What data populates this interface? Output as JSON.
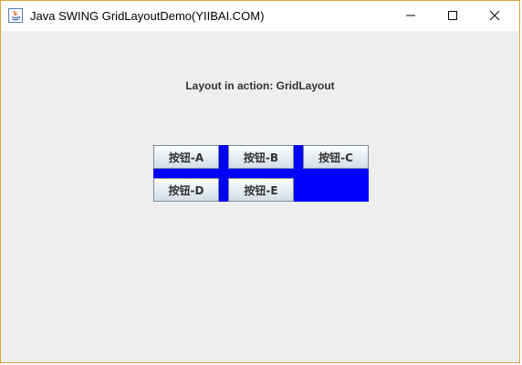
{
  "window": {
    "title": "Java SWING GridLayoutDemo(YIIBAI.COM)",
    "icon": "java-icon",
    "controls": [
      "minimize-icon",
      "maximize-icon",
      "close-icon"
    ],
    "accent_border": "#e3a33a"
  },
  "content": {
    "label": "Layout in action: GridLayout",
    "panel_color": "#0000ff",
    "buttons": [
      {
        "label": "按钮-A"
      },
      {
        "label": "按钮-B"
      },
      {
        "label": "按钮-C"
      },
      {
        "label": "按钮-D"
      },
      {
        "label": "按钮-E"
      }
    ]
  }
}
